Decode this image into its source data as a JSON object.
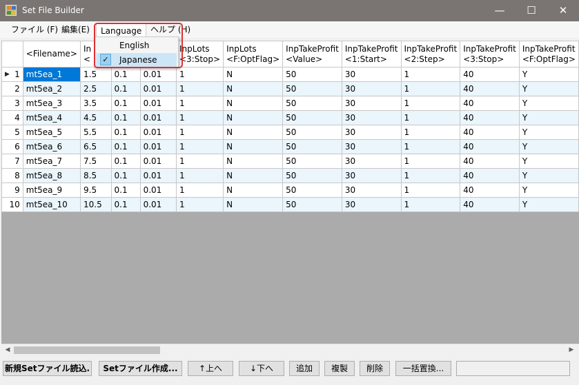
{
  "window": {
    "title": "Set File Builder",
    "minimize_glyph": "—",
    "maximize_glyph": "☐",
    "close_glyph": "✕",
    "app_icon": "grid-app-icon"
  },
  "menu": {
    "file": "ファイル (F)",
    "edit": "編集(E)",
    "language": "Language",
    "help": "ヘルプ (H)"
  },
  "language_menu": {
    "items": [
      {
        "label": "English",
        "checked": false
      },
      {
        "label": "Japanese",
        "checked": true
      }
    ],
    "check_glyph": "✓"
  },
  "grid": {
    "columns": [
      [
        "<Filename>",
        ""
      ],
      [
        "In",
        "<"
      ],
      [
        "",
        ""
      ],
      [
        "Lots",
        "Step>"
      ],
      [
        "InpLots",
        "<3:Stop>"
      ],
      [
        "InpLots",
        "<F:OptFlag>"
      ],
      [
        "InpTakeProfit",
        "<Value>"
      ],
      [
        "InpTakeProfit",
        "<1:Start>"
      ],
      [
        "InpTakeProfit",
        "<2:Step>"
      ],
      [
        "InpTakeProfit",
        "<3:Stop>"
      ],
      [
        "InpTakeProfit",
        "<F:OptFlag>"
      ]
    ],
    "row_numbers": [
      "1",
      "2",
      "3",
      "4",
      "5",
      "6",
      "7",
      "8",
      "9",
      "10"
    ],
    "current_row_marker": "▶",
    "rows": [
      [
        "mt5ea_1",
        "1.5",
        "0.1",
        "0.01",
        "1",
        "N",
        "50",
        "30",
        "1",
        "40",
        "Y"
      ],
      [
        "mt5ea_2",
        "2.5",
        "0.1",
        "0.01",
        "1",
        "N",
        "50",
        "30",
        "1",
        "40",
        "Y"
      ],
      [
        "mt5ea_3",
        "3.5",
        "0.1",
        "0.01",
        "1",
        "N",
        "50",
        "30",
        "1",
        "40",
        "Y"
      ],
      [
        "mt5ea_4",
        "4.5",
        "0.1",
        "0.01",
        "1",
        "N",
        "50",
        "30",
        "1",
        "40",
        "Y"
      ],
      [
        "mt5ea_5",
        "5.5",
        "0.1",
        "0.01",
        "1",
        "N",
        "50",
        "30",
        "1",
        "40",
        "Y"
      ],
      [
        "mt5ea_6",
        "6.5",
        "0.1",
        "0.01",
        "1",
        "N",
        "50",
        "30",
        "1",
        "40",
        "Y"
      ],
      [
        "mt5ea_7",
        "7.5",
        "0.1",
        "0.01",
        "1",
        "N",
        "50",
        "30",
        "1",
        "40",
        "Y"
      ],
      [
        "mt5ea_8",
        "8.5",
        "0.1",
        "0.01",
        "1",
        "N",
        "50",
        "30",
        "1",
        "40",
        "Y"
      ],
      [
        "mt5ea_9",
        "9.5",
        "0.1",
        "0.01",
        "1",
        "N",
        "50",
        "30",
        "1",
        "40",
        "Y"
      ],
      [
        "mt5ea_10",
        "10.5",
        "0.1",
        "0.01",
        "1",
        "N",
        "50",
        "30",
        "1",
        "40",
        "Y"
      ]
    ]
  },
  "scrollbar": {
    "left_glyph": "◀",
    "right_glyph": "▶"
  },
  "toolbar": {
    "load_new": "新規Setファイル読込.",
    "create_set": "Setファイル作成...",
    "move_up": "↑上へ",
    "move_down": "↓下へ",
    "add": "追加",
    "duplicate": "複製",
    "delete": "削除",
    "bulk_replace": "一括置換...",
    "status": ""
  },
  "colors": {
    "selection": "#0078d7",
    "alt_row": "#eaf5fc",
    "highlight_outline": "#e03030",
    "titlebar": "#7a7572"
  }
}
